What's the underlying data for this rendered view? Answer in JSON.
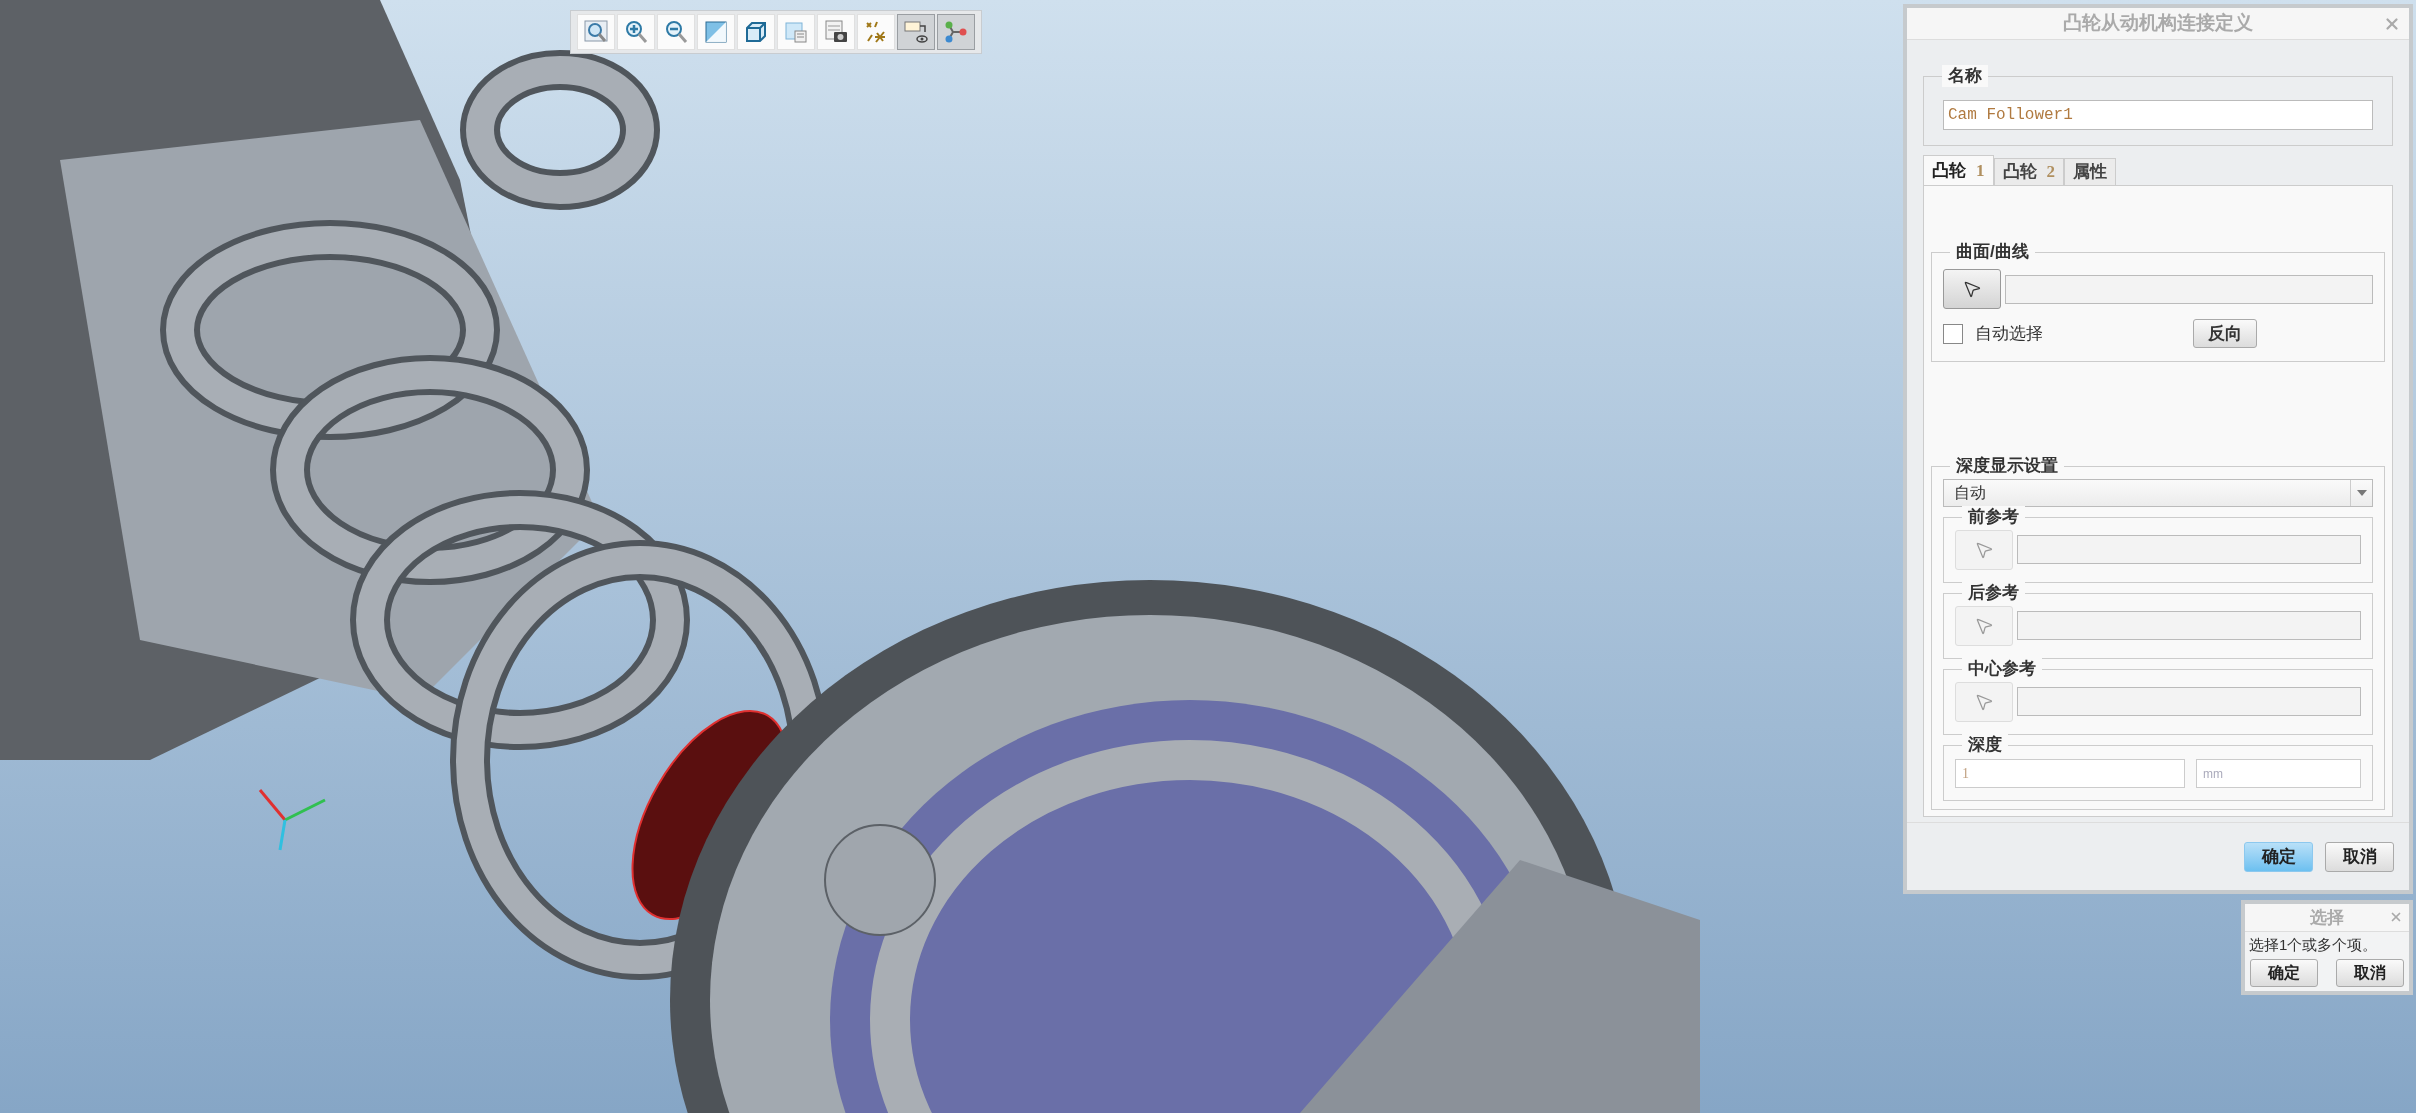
{
  "viewport": {
    "toolbar": [
      {
        "kind": "zoom-fit",
        "selected": false
      },
      {
        "kind": "zoom-in",
        "selected": false
      },
      {
        "kind": "zoom-out",
        "selected": false
      },
      {
        "kind": "repaint",
        "selected": false
      },
      {
        "kind": "display-style",
        "selected": false
      },
      {
        "kind": "saved-views",
        "selected": false
      },
      {
        "kind": "view-manager",
        "selected": false
      },
      {
        "kind": "datum-display",
        "selected": false
      },
      {
        "kind": "annotation-display",
        "selected": true
      },
      {
        "kind": "spin-center",
        "selected": true
      }
    ]
  },
  "dialog": {
    "title": "凸轮从动机构连接定义",
    "name_group": {
      "label": "名称",
      "value": "Cam Follower1"
    },
    "tabs": [
      {
        "label": "凸轮",
        "index": "1",
        "selected": true
      },
      {
        "label": "凸轮",
        "index": "2",
        "selected": false
      },
      {
        "label": "属性",
        "selected": false
      }
    ],
    "surface_group": {
      "label": "曲面/曲线",
      "auto_select": {
        "label": "自动选择",
        "checked": false
      },
      "reverse_button": "反向"
    },
    "depth_group": {
      "label": "深度显示设置",
      "dropdown": "自动",
      "references": [
        {
          "label": "前参考",
          "disabled": true
        },
        {
          "label": "后参考",
          "disabled": true
        },
        {
          "label": "中心参考",
          "disabled": true
        }
      ],
      "depth": {
        "label": "深度",
        "value": "1",
        "unit": "mm",
        "disabled": true
      }
    },
    "buttons": [
      {
        "label": "确定",
        "default": true
      },
      {
        "label": "取消",
        "default": false
      }
    ]
  },
  "selection_dialog": {
    "title": "选择",
    "message": "选择1个或多个项。",
    "buttons": [
      "确定",
      "取消"
    ]
  }
}
